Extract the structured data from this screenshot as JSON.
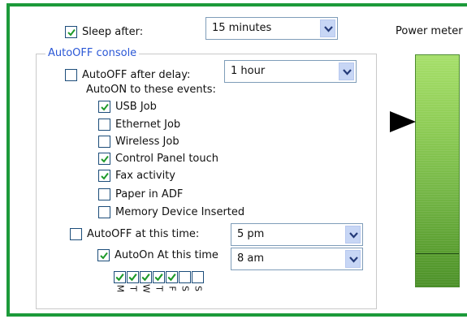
{
  "sleep": {
    "label": "Sleep after:",
    "checked": true,
    "value": "15 minutes"
  },
  "power_meter": {
    "label": "Power meter",
    "level": 0.85
  },
  "autooff_console": {
    "legend": "AutoOFF console",
    "after_delay": {
      "label": "AutoOFF after delay:",
      "checked": false,
      "value": "1 hour"
    },
    "events_heading": "AutoON to these events:",
    "events": [
      {
        "label": "USB Job",
        "checked": true
      },
      {
        "label": "Ethernet Job",
        "checked": false
      },
      {
        "label": "Wireless Job",
        "checked": false
      },
      {
        "label": "Control Panel touch",
        "checked": true
      },
      {
        "label": "Fax activity",
        "checked": true
      },
      {
        "label": "Paper in ADF",
        "checked": false
      },
      {
        "label": "Memory Device Inserted",
        "checked": false
      }
    ],
    "at_time": {
      "label": "AutoOFF at this time:",
      "checked": false,
      "value": "5 pm"
    },
    "autoon_time": {
      "label": "AutoOn At this time",
      "checked": true,
      "value": "8 am"
    },
    "days": [
      {
        "label": "M",
        "checked": true
      },
      {
        "label": "T",
        "checked": true
      },
      {
        "label": "W",
        "checked": true
      },
      {
        "label": "T",
        "checked": true
      },
      {
        "label": "F",
        "checked": true
      },
      {
        "label": "S",
        "checked": false
      },
      {
        "label": "S",
        "checked": false
      }
    ]
  },
  "colors": {
    "frame": "#1c9a3a",
    "legend": "#2a57d6",
    "check": "#1e9a2a",
    "meter": "#7cc24e"
  }
}
